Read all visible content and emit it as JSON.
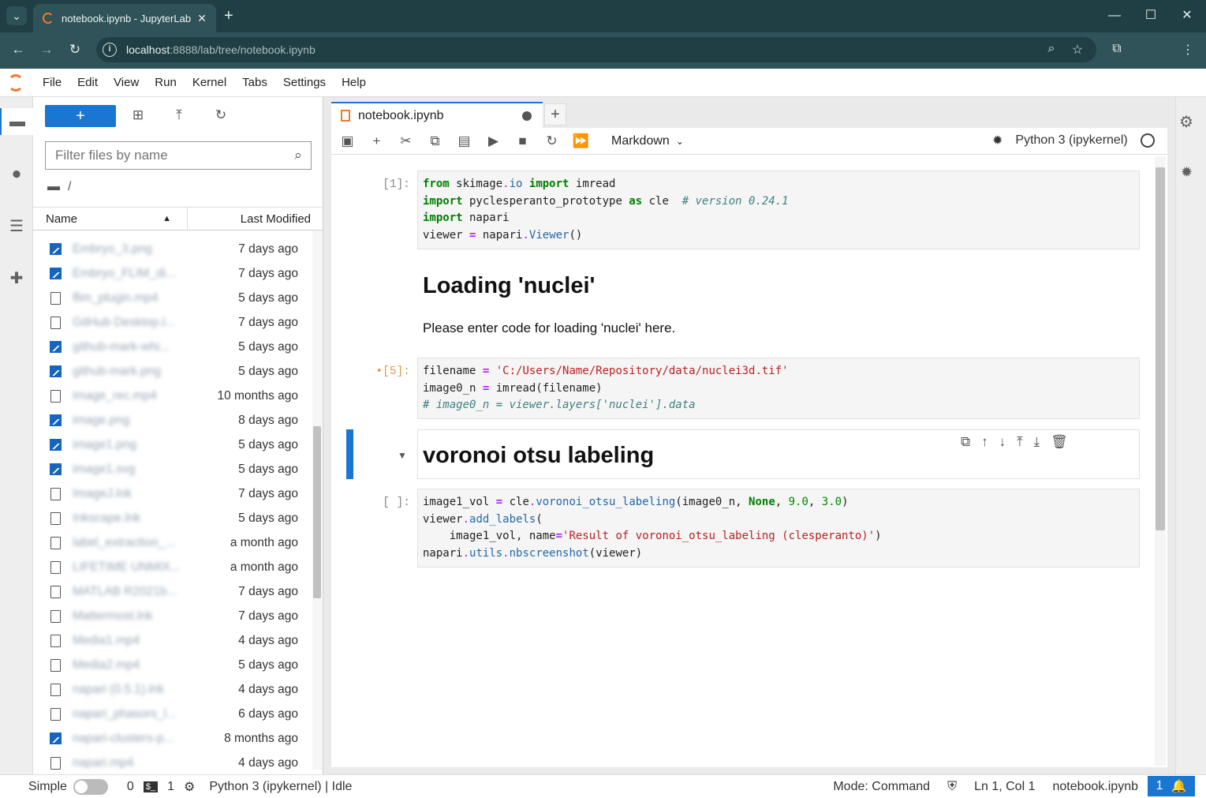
{
  "browser": {
    "tab_title": "notebook.ipynb - JupyterLab",
    "url_host": "localhost",
    "url_rest": ":8888/lab/tree/notebook.ipynb"
  },
  "menu": [
    "File",
    "Edit",
    "View",
    "Run",
    "Kernel",
    "Tabs",
    "Settings",
    "Help"
  ],
  "filebrowser": {
    "filter_placeholder": "Filter files by name",
    "path": "/",
    "col_name": "Name",
    "col_modified": "Last Modified",
    "files": [
      {
        "name": "Embryo_3.png",
        "type": "image",
        "modified": "7 days ago"
      },
      {
        "name": "Embryo_FLIM_di...",
        "type": "image",
        "modified": "7 days ago"
      },
      {
        "name": "flim_plugin.mp4",
        "type": "file",
        "modified": "5 days ago"
      },
      {
        "name": "GitHub Desktop.l...",
        "type": "file",
        "modified": "7 days ago"
      },
      {
        "name": "github-mark-whi...",
        "type": "image",
        "modified": "5 days ago"
      },
      {
        "name": "github-mark.png",
        "type": "image",
        "modified": "5 days ago"
      },
      {
        "name": "image_rec.mp4",
        "type": "file",
        "modified": "10 months ago"
      },
      {
        "name": "image.png",
        "type": "image",
        "modified": "8 days ago"
      },
      {
        "name": "image1.png",
        "type": "image",
        "modified": "5 days ago"
      },
      {
        "name": "image1.svg",
        "type": "image",
        "modified": "5 days ago"
      },
      {
        "name": "ImageJ.lnk",
        "type": "file",
        "modified": "7 days ago"
      },
      {
        "name": "Inkscape.lnk",
        "type": "file",
        "modified": "5 days ago"
      },
      {
        "name": "label_extraction_...",
        "type": "file",
        "modified": "a month ago"
      },
      {
        "name": "LIFETIME UNMIX...",
        "type": "file",
        "modified": "a month ago"
      },
      {
        "name": "MATLAB R2021b...",
        "type": "file",
        "modified": "7 days ago"
      },
      {
        "name": "Mattermost.lnk",
        "type": "file",
        "modified": "7 days ago"
      },
      {
        "name": "Media1.mp4",
        "type": "file",
        "modified": "4 days ago"
      },
      {
        "name": "Media2.mp4",
        "type": "file",
        "modified": "5 days ago"
      },
      {
        "name": "napari (0.5.1).lnk",
        "type": "file",
        "modified": "4 days ago"
      },
      {
        "name": "napari_phasors_l...",
        "type": "file",
        "modified": "6 days ago"
      },
      {
        "name": "napari-clusters-p...",
        "type": "image",
        "modified": "8 months ago"
      },
      {
        "name": "napari.mp4",
        "type": "file",
        "modified": "4 days ago"
      }
    ]
  },
  "notebook": {
    "tab_title": "notebook.ipynb",
    "cell_type": "Markdown",
    "kernel": "Python 3 (ipykernel)",
    "cell1_prompt": "[1]:",
    "heading1": "Loading 'nuclei'",
    "para1": "Please enter code for loading 'nuclei' here.",
    "cell2_prompt": "•[5]:",
    "heading2": "voronoi otsu labeling",
    "cell3_prompt": "[ ]:"
  },
  "status": {
    "simple": "Simple",
    "num0": "0",
    "num1": "1",
    "kernel_state": "Python 3 (ipykernel) | Idle",
    "mode": "Mode: Command",
    "position": "Ln 1, Col 1",
    "filename": "notebook.ipynb",
    "notifications": "1"
  }
}
